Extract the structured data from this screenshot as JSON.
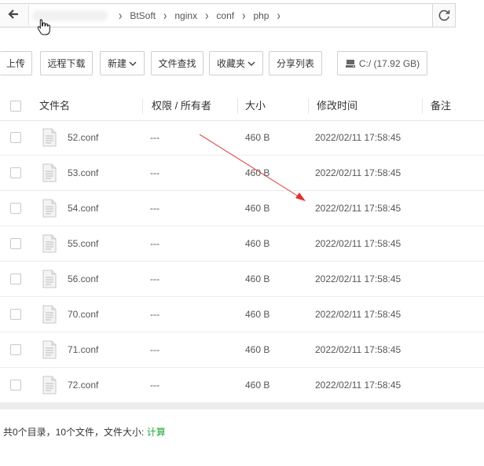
{
  "address_bar": {
    "crumbs": [
      "BtSoft",
      "nginx",
      "conf",
      "php"
    ]
  },
  "toolbar": {
    "upload": "上传",
    "remote_download": "远程下载",
    "new": "新建",
    "file_search": "文件查找",
    "favorites": "收藏夹",
    "share_list": "分享列表",
    "disk": "C:/ (17.92 GB)"
  },
  "table": {
    "headers": [
      "文件名",
      "权限 / 所有者",
      "大小",
      "修改时间",
      "备注"
    ],
    "rows": [
      {
        "name": "52.conf",
        "perm": "---",
        "size": "460 B",
        "mtime": "2022/02/11 17:58:45"
      },
      {
        "name": "53.conf",
        "perm": "---",
        "size": "460 B",
        "mtime": "2022/02/11 17:58:45"
      },
      {
        "name": "54.conf",
        "perm": "---",
        "size": "460 B",
        "mtime": "2022/02/11 17:58:45"
      },
      {
        "name": "55.conf",
        "perm": "---",
        "size": "460 B",
        "mtime": "2022/02/11 17:58:45"
      },
      {
        "name": "56.conf",
        "perm": "---",
        "size": "460 B",
        "mtime": "2022/02/11 17:58:45"
      },
      {
        "name": "70.conf",
        "perm": "---",
        "size": "460 B",
        "mtime": "2022/02/11 17:58:45"
      },
      {
        "name": "71.conf",
        "perm": "---",
        "size": "460 B",
        "mtime": "2022/02/11 17:58:45"
      },
      {
        "name": "72.conf",
        "perm": "---",
        "size": "460 B",
        "mtime": "2022/02/11 17:58:45"
      }
    ]
  },
  "footer": {
    "summary": "共0个目录，10个文件，文件大小:",
    "calc": "计算"
  },
  "colors": {
    "accent_green": "#20a53a",
    "annotation_arrow": "#e03030"
  }
}
